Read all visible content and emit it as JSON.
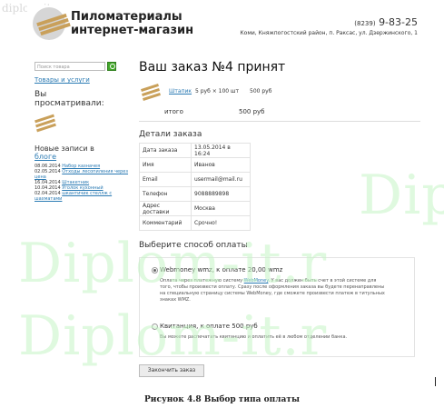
{
  "watermark": {
    "top": "diplom-it.ru",
    "big": "Diplom-it.r"
  },
  "header": {
    "logo_title": "Пиломатериалы",
    "logo_subtitle": "интернет-магазин",
    "phone_code": "(8239)",
    "phone_number": "9-83-25",
    "address": "Коми, Княжпогостский район, п. Раксас, ул. Дзержинского, 1"
  },
  "sidebar": {
    "search_placeholder": "Поиск товара",
    "goods_link": "Товары и услуги",
    "viewed_title": "Вы просматривали:",
    "blog_title_prefix": "Новые записи в",
    "blog_link": "блоге",
    "blog_entries": [
      {
        "date": "08.06.2014",
        "title": "Набор казначея"
      },
      {
        "date": "02.05.2014",
        "title": "Отходы лесопиления через"
      },
      {
        "date": "",
        "title": "цена"
      },
      {
        "date": "16.04.2014",
        "title": "Штакетник"
      },
      {
        "date": "10.04.2014",
        "title": "Уголок кухонный"
      },
      {
        "date": "02.04.2014",
        "title": "шкантичик стеллж с"
      },
      {
        "date": "",
        "title": "шахматами"
      }
    ]
  },
  "order": {
    "title": "Ваш заказ №4 принят",
    "item_name": "Штапик",
    "item_qty": "5 руб × 100 шт",
    "item_price": "500 руб",
    "total_label": "итого",
    "total_value": "500 руб"
  },
  "details": {
    "title": "Детали заказа",
    "rows": [
      {
        "key": "Дата заказа",
        "value": "13.05.2014 в 16:24"
      },
      {
        "key": "Имя",
        "value": "Иванов"
      },
      {
        "key": "Email",
        "value": "usermail@mail.ru"
      },
      {
        "key": "Телефон",
        "value": "9088889898"
      },
      {
        "key": "Адрес доставки",
        "value": "Москва"
      },
      {
        "key": "Комментарий",
        "value": "Срочно!"
      }
    ]
  },
  "payment": {
    "title": "Выберите способ оплаты",
    "options": [
      {
        "label": "Webmoney wmz, к оплате 20,00 wmz",
        "selected": true,
        "desc_1": "Оплата через платежную систему",
        "desc_link": "WebMoney",
        "desc_2": ". У вас должен быть счет в этой системе для",
        "desc_3": "того, чтобы произвести оплату. Сразу после оформления заказа вы будете перенаправлены",
        "desc_4": "на специальную страницу системы WebMoney, где сможете произвести платеж в титульных",
        "desc_5": "знаках WMZ."
      },
      {
        "label": "Квитанция, к оплате 500 руб",
        "selected": false,
        "desc_1": "Вы можете распечатать квитанцию и оплатить её в любом отделении банка."
      }
    ],
    "finish_button": "Закончить заказ"
  },
  "caption": "Рисунок 4.8 Выбор типа оплаты"
}
